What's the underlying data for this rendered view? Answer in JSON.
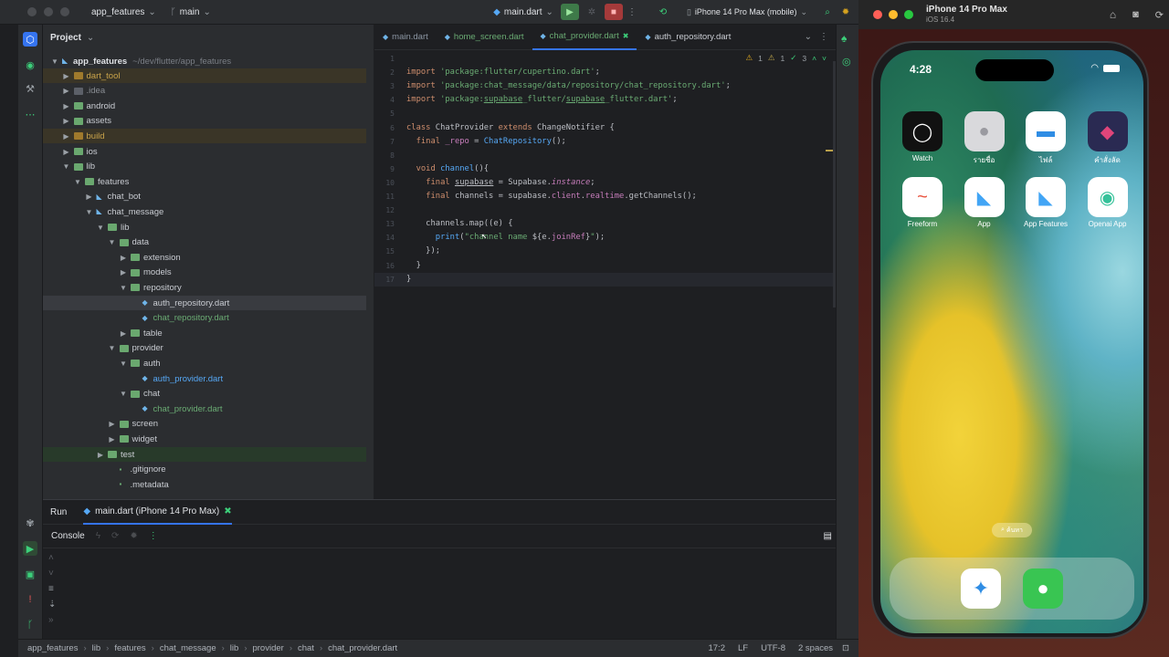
{
  "titlebar": {
    "project_name": "app_features",
    "branch": "main",
    "run_config": "main.dart",
    "device": "iPhone 14 Pro Max (mobile)"
  },
  "project_panel": {
    "title": "Project",
    "root_name": "app_features",
    "root_path": "~/dev/flutter/app_features",
    "items": [
      {
        "label": "dart_tool",
        "level": 1,
        "kind": "folder",
        "state": "closed",
        "color": "#c9a34a",
        "bg": "#3a3527"
      },
      {
        "label": ".idea",
        "level": 1,
        "kind": "folder",
        "state": "closed",
        "color": "#8a8e94",
        "bg": ""
      },
      {
        "label": "android",
        "level": 1,
        "kind": "folder",
        "state": "closed",
        "color": "#c9ccd2",
        "bg": ""
      },
      {
        "label": "assets",
        "level": 1,
        "kind": "folder",
        "state": "closed",
        "color": "#c9ccd2",
        "bg": ""
      },
      {
        "label": "build",
        "level": 1,
        "kind": "folder",
        "state": "closed",
        "color": "#c9a34a",
        "bg": "#3a3527"
      },
      {
        "label": "ios",
        "level": 1,
        "kind": "folder",
        "state": "closed",
        "color": "#c9ccd2",
        "bg": ""
      },
      {
        "label": "lib",
        "level": 1,
        "kind": "folder",
        "state": "open",
        "color": "#c9ccd2",
        "bg": ""
      },
      {
        "label": "features",
        "level": 2,
        "kind": "folder",
        "state": "open",
        "color": "#c9ccd2",
        "bg": ""
      },
      {
        "label": "chat_bot",
        "level": 3,
        "kind": "module",
        "state": "closed",
        "color": "#c9ccd2",
        "bg": ""
      },
      {
        "label": "chat_message",
        "level": 3,
        "kind": "module",
        "state": "open",
        "color": "#c9ccd2",
        "bg": ""
      },
      {
        "label": "lib",
        "level": 4,
        "kind": "folder",
        "state": "open",
        "color": "#c9ccd2",
        "bg": ""
      },
      {
        "label": "data",
        "level": 5,
        "kind": "folder",
        "state": "open",
        "color": "#c9ccd2",
        "bg": ""
      },
      {
        "label": "extension",
        "level": 6,
        "kind": "folder",
        "state": "closed",
        "color": "#c9ccd2",
        "bg": ""
      },
      {
        "label": "models",
        "level": 6,
        "kind": "folder",
        "state": "closed",
        "color": "#c9ccd2",
        "bg": ""
      },
      {
        "label": "repository",
        "level": 6,
        "kind": "folder",
        "state": "open",
        "color": "#c9ccd2",
        "bg": ""
      },
      {
        "label": "auth_repository.dart",
        "level": 7,
        "kind": "file",
        "state": "",
        "color": "#c9ccd2",
        "bg": "#393b40"
      },
      {
        "label": "chat_repository.dart",
        "level": 7,
        "kind": "file",
        "state": "",
        "color": "#6aab73",
        "bg": ""
      },
      {
        "label": "table",
        "level": 6,
        "kind": "folder",
        "state": "closed",
        "color": "#c9ccd2",
        "bg": ""
      },
      {
        "label": "provider",
        "level": 5,
        "kind": "folder",
        "state": "open",
        "color": "#c9ccd2",
        "bg": ""
      },
      {
        "label": "auth",
        "level": 6,
        "kind": "folder",
        "state": "open",
        "color": "#c9ccd2",
        "bg": ""
      },
      {
        "label": "auth_provider.dart",
        "level": 7,
        "kind": "file",
        "state": "",
        "color": "#56a8f5",
        "bg": ""
      },
      {
        "label": "chat",
        "level": 6,
        "kind": "folder",
        "state": "open",
        "color": "#c9ccd2",
        "bg": ""
      },
      {
        "label": "chat_provider.dart",
        "level": 7,
        "kind": "file",
        "state": "",
        "color": "#6aab73",
        "bg": ""
      },
      {
        "label": "screen",
        "level": 5,
        "kind": "folder",
        "state": "closed",
        "color": "#c9ccd2",
        "bg": ""
      },
      {
        "label": "widget",
        "level": 5,
        "kind": "folder",
        "state": "closed",
        "color": "#c9ccd2",
        "bg": ""
      },
      {
        "label": "test",
        "level": 4,
        "kind": "folder",
        "state": "closed",
        "color": "#c9ccd2",
        "bg": "#283a2a"
      },
      {
        "label": ".gitignore",
        "level": 5,
        "kind": "plainfile",
        "state": "",
        "color": "#c9ccd2",
        "bg": ""
      },
      {
        "label": ".metadata",
        "level": 5,
        "kind": "plainfile",
        "state": "",
        "color": "#c9ccd2",
        "bg": ""
      }
    ]
  },
  "editor": {
    "tabs": [
      {
        "label": "main.dart",
        "active": false,
        "color": "#8c96a3"
      },
      {
        "label": "home_screen.dart",
        "active": false,
        "color": "#6aab73"
      },
      {
        "label": "chat_provider.dart",
        "active": true,
        "color": "#6aab73"
      },
      {
        "label": "auth_repository.dart",
        "active": false,
        "color": "#c9ccd2"
      }
    ],
    "inspections": {
      "warn1": "1",
      "warn2": "1",
      "weak": "3"
    },
    "lines": [
      {
        "n": "1",
        "html": ""
      },
      {
        "n": "2",
        "html": "<span class='kw'>import</span> <span class='str'>'package:flutter/cupertino.dart'</span>;"
      },
      {
        "n": "3",
        "html": "<span class='kw'>import</span> <span class='str'>'package:chat_message/data/repository/chat_repository.dart'</span>;"
      },
      {
        "n": "4",
        "html": "<span class='kw'>import</span> <span class='str'>'package:<u>supabase</u>_flutter/<u>supabase</u>_flutter.dart'</span>;"
      },
      {
        "n": "5",
        "html": ""
      },
      {
        "n": "6",
        "html": "<span class='kw'>class</span> ChatProvider <span class='kw'>extends</span> ChangeNotifier {"
      },
      {
        "n": "7",
        "html": "  <span class='kw'>final</span> <span class='prop'>_repo</span> = <span class='fn'>ChatRepository</span>();"
      },
      {
        "n": "8",
        "html": ""
      },
      {
        "n": "9",
        "html": "  <span class='kw'>void</span> <span class='fn'>channel</span>(){"
      },
      {
        "n": "10",
        "html": "    <span class='kw'>final</span> <u>supabase</u> = Supabase.<span class='it'>instance</span>;"
      },
      {
        "n": "11",
        "html": "    <span class='kw'>final</span> channels = supabase.<span class='prop'>client</span>.<span class='prop'>realtime</span>.getChannels();"
      },
      {
        "n": "12",
        "html": ""
      },
      {
        "n": "13",
        "html": "    channels.map((e) {"
      },
      {
        "n": "14",
        "html": "      <span class='fn'>print</span>(<span class='str'>\"channel name </span>${e.<span class='prop'>joinRef</span>}<span class='str'>\"</span>);"
      },
      {
        "n": "15",
        "html": "    });"
      },
      {
        "n": "16",
        "html": "  }"
      },
      {
        "n": "17",
        "html": "}"
      }
    ]
  },
  "run_panel": {
    "run_label": "Run",
    "run_tab": "main.dart (iPhone 14 Pro Max)",
    "console_label": "Console"
  },
  "statusbar": {
    "crumbs": [
      "app_features",
      "lib",
      "features",
      "chat_message",
      "lib",
      "provider",
      "chat",
      "chat_provider.dart"
    ],
    "position": "17:2",
    "line_sep": "LF",
    "encoding": "UTF-8",
    "indent": "2 spaces"
  },
  "simulator": {
    "device": "iPhone 14 Pro Max",
    "os": "iOS 16.4",
    "time": "4:28",
    "search": "ค้นหา",
    "apps": [
      {
        "label": "Watch",
        "bg": "#111111",
        "glyph": "◯",
        "fg": "#ffffff"
      },
      {
        "label": "รายชื่อ",
        "bg": "#d9d9dc",
        "glyph": "●",
        "fg": "#9a9aa0"
      },
      {
        "label": "ไฟล์",
        "bg": "#ffffff",
        "glyph": "▬",
        "fg": "#2f8de4"
      },
      {
        "label": "คำสั่งลัด",
        "bg": "#2a2a52",
        "glyph": "◆",
        "fg": "#e0457a"
      },
      {
        "label": "Freeform",
        "bg": "#ffffff",
        "glyph": "~",
        "fg": "#e9543f"
      },
      {
        "label": "App",
        "bg": "#ffffff",
        "glyph": "◣",
        "fg": "#42a5f5"
      },
      {
        "label": "App Features",
        "bg": "#ffffff",
        "glyph": "◣",
        "fg": "#42a5f5"
      },
      {
        "label": "Openai App",
        "bg": "#ffffff",
        "glyph": "◉",
        "fg": "#36c29a"
      }
    ],
    "dock": [
      {
        "name": "safari",
        "bg": "#ffffff",
        "glyph": "✦",
        "fg": "#2f8de4"
      },
      {
        "name": "messages",
        "bg": "#39c552",
        "glyph": "●",
        "fg": "#ffffff"
      }
    ]
  }
}
